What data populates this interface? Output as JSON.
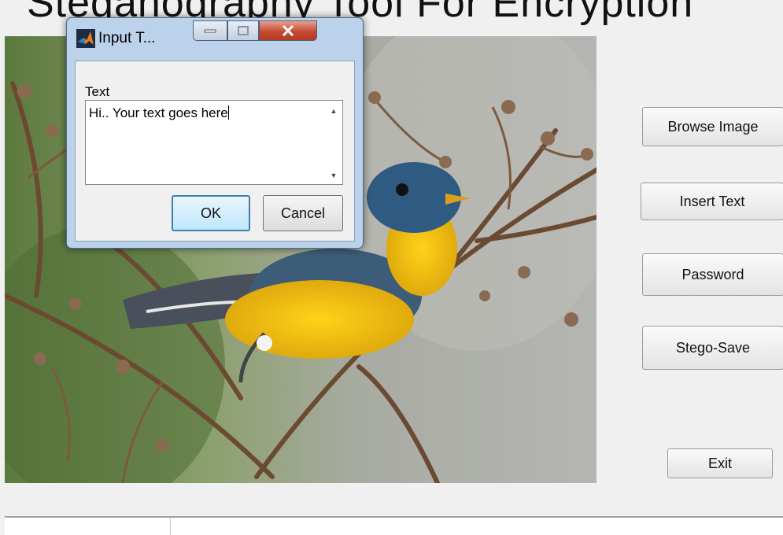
{
  "app": {
    "title": "Steganography Tool For Encryption"
  },
  "buttons": {
    "browse": "Browse Image",
    "insert": "Insert Text",
    "password": "Password",
    "stego_save": "Stego-Save",
    "exit": "Exit"
  },
  "dialog": {
    "title": "Input T...",
    "label": "Text",
    "text_value": "Hi.. Your text goes here",
    "ok": "OK",
    "cancel": "Cancel",
    "icon": "matlab-logo-icon"
  },
  "colors": {
    "accent": "#3c7fb1",
    "close_button": "#c74a31"
  }
}
